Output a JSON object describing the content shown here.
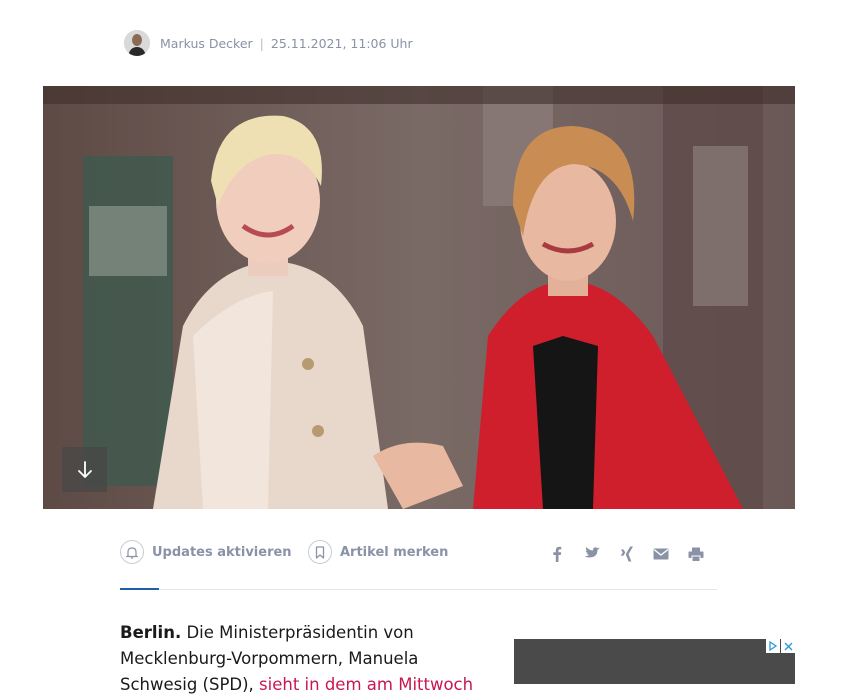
{
  "author": {
    "name": "Markus Decker",
    "separator": "|",
    "date": "25.11.2021, 11:06 Uhr"
  },
  "hero": {
    "scroll_icon": "arrow-down-icon"
  },
  "actions": {
    "updates_label": "Updates aktivieren",
    "updates_icon": "bell-icon",
    "bookmark_label": "Artikel merken",
    "bookmark_icon": "bookmark-icon"
  },
  "share": [
    "facebook-icon",
    "twitter-icon",
    "xing-icon",
    "mail-icon",
    "print-icon"
  ],
  "article": {
    "place": "Berlin.",
    "text": " Die Ministerpräsidentin von Mecklenburg-Vorpommern, Manuela Schwesig (SPD), ",
    "link_text": "sieht in dem am Mittwoch"
  },
  "ad": {
    "badges": [
      "adchoices-icon",
      "close-icon"
    ]
  },
  "colors": {
    "link": "#c8174f",
    "meta": "#8a92a6",
    "accent": "#1f5fa8"
  }
}
